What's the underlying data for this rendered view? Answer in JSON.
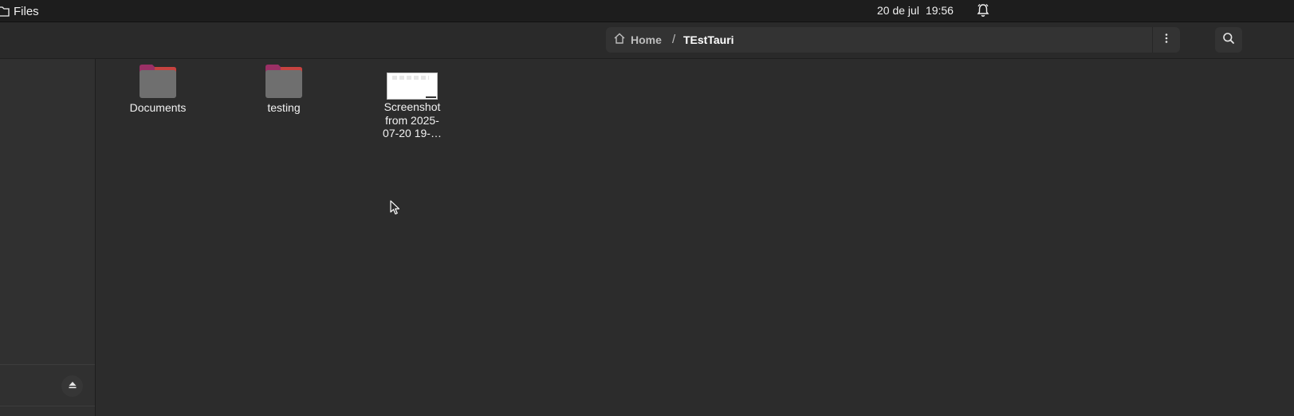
{
  "topbar": {
    "app_name": "Files",
    "date": "20 de jul",
    "time": "19:56"
  },
  "header": {
    "breadcrumb_home": "Home",
    "breadcrumb_separator": "/",
    "breadcrumb_current": "TEstTauri"
  },
  "files": [
    {
      "name": "Documents",
      "type": "folder"
    },
    {
      "name": "testing",
      "type": "folder"
    },
    {
      "name_lines": [
        "Screenshot",
        "from 2025-",
        "07-20 19-…"
      ],
      "type": "image"
    }
  ],
  "colors": {
    "folder_tab": "#9b3066",
    "folder_tab_edge": "#e95420",
    "folder_body": "#6f6f6f",
    "background": "#2c2c2c"
  },
  "icons": [
    "folder-icon",
    "home-icon",
    "kebab-menu-icon",
    "search-icon",
    "bell-icon",
    "eject-icon"
  ]
}
